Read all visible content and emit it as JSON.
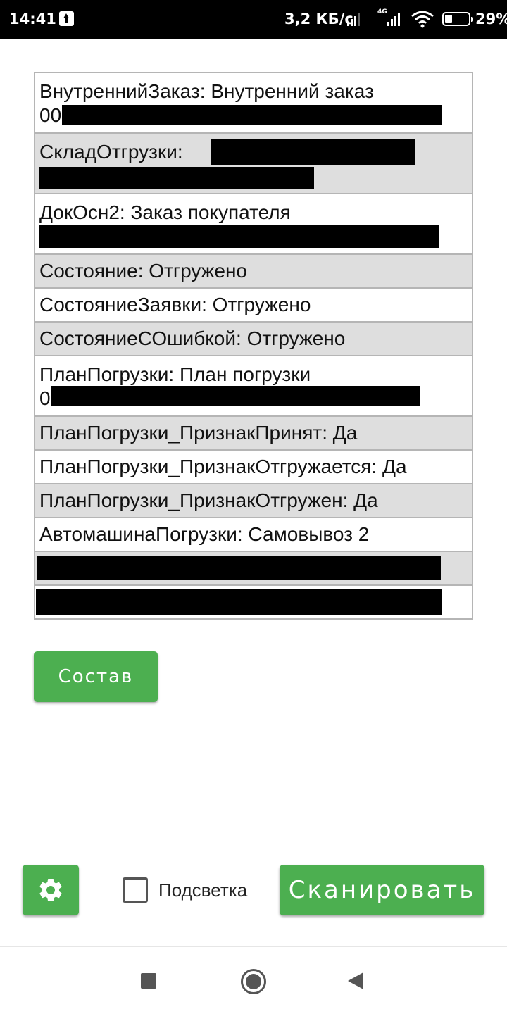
{
  "status_bar": {
    "time": "14:41",
    "network_speed": "3,2 КБ/с",
    "network_type": "4G",
    "battery": "29%"
  },
  "info_table": {
    "rows": [
      {
        "text": "ВнутреннийЗаказ: Внутренний заказ",
        "tail": "00"
      },
      {
        "text": "СкладОтгрузки:"
      },
      {
        "text": "ДокОсн2: Заказ покупателя"
      },
      {
        "text": "Состояние: Отгружено"
      },
      {
        "text": "СостояниеЗаявки: Отгружено"
      },
      {
        "text": "СостояниеСОшибкой: Отгружено"
      },
      {
        "text": "ПланПогрузки: План погрузки",
        "tail": "0"
      },
      {
        "text": "ПланПогрузки_ПризнакПринят: Да"
      },
      {
        "text": "ПланПогрузки_ПризнакОтгружается: Да"
      },
      {
        "text": "ПланПогрузки_ПризнакОтгружен: Да"
      },
      {
        "text": "АвтомашинаПогрузки: Самовывоз 2"
      }
    ]
  },
  "buttons": {
    "sostav": "Состав",
    "scan": "Сканировать"
  },
  "backlight": {
    "label": "Подсветка",
    "checked": false
  },
  "icons": {
    "settings": "gear-icon",
    "nav_recents": "square-icon",
    "nav_home": "circle-icon",
    "nav_back": "triangle-back-icon"
  },
  "colors": {
    "accent": "#4caf50",
    "row_alt": "#dedede",
    "border": "#b5b5b5"
  }
}
